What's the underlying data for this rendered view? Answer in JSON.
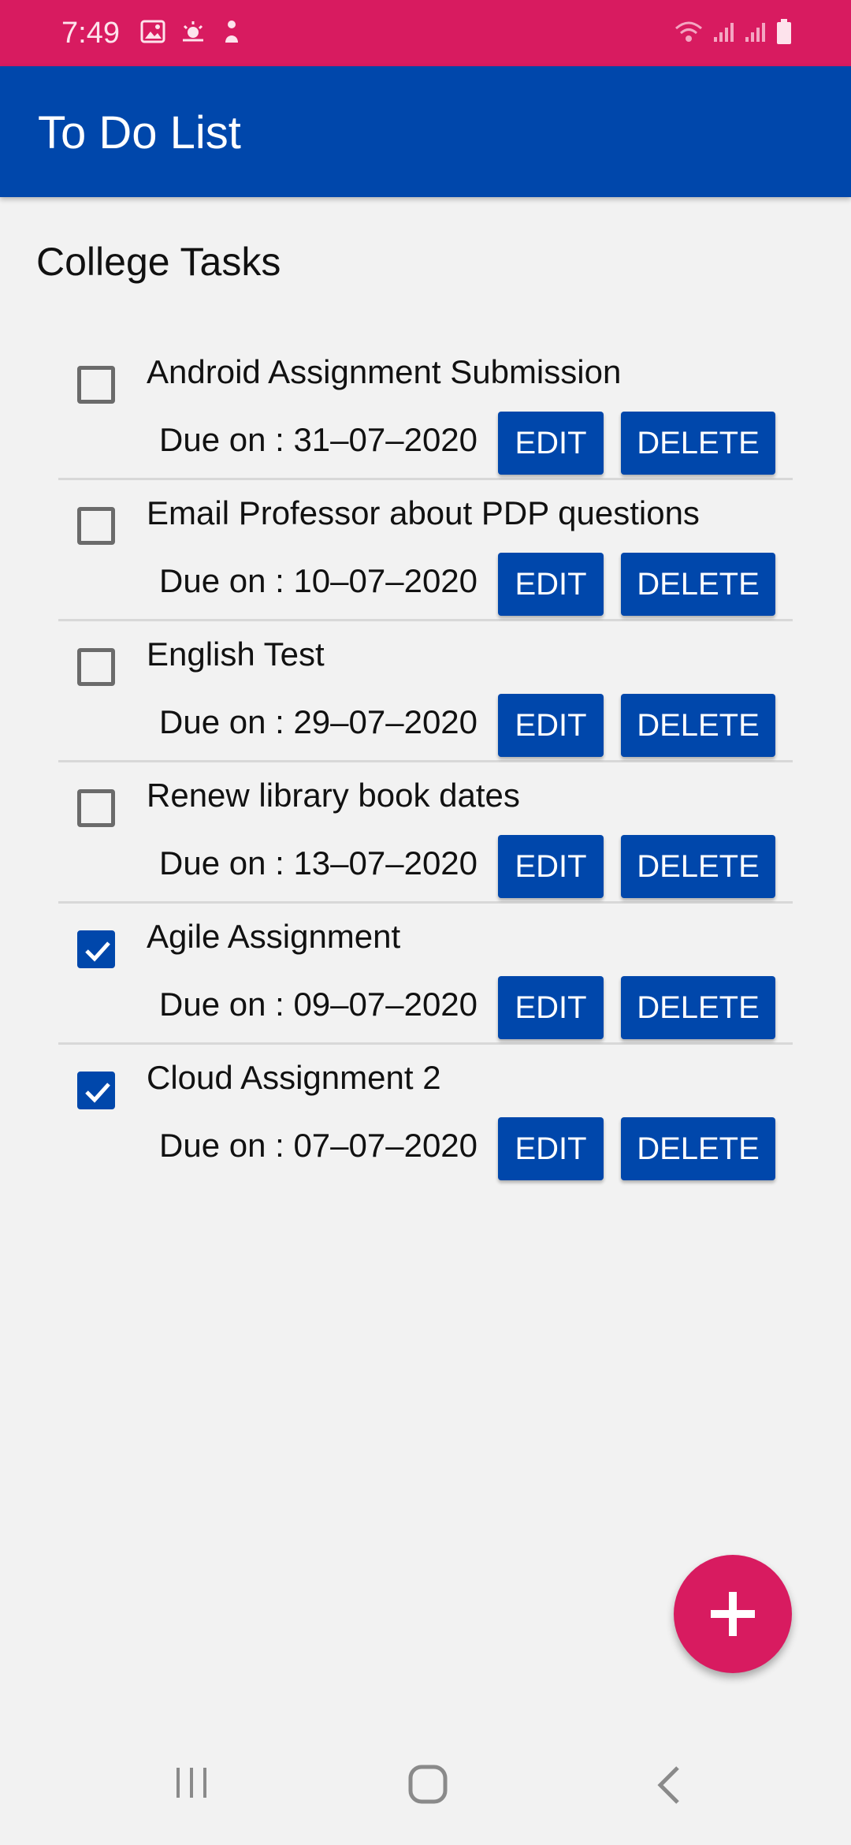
{
  "status_bar": {
    "time": "7:49",
    "left_icons": [
      "image-icon",
      "weather-icon",
      "notification-icon"
    ],
    "right_icons": [
      "wifi-icon",
      "signal-icon",
      "signal-icon",
      "battery-icon"
    ]
  },
  "app_bar": {
    "title": "To Do List"
  },
  "section": {
    "title": "College Tasks"
  },
  "buttons": {
    "edit": "EDIT",
    "delete": "DELETE"
  },
  "tasks": [
    {
      "title": "Android Assignment Submission",
      "due": "Due on : 31–07–2020",
      "checked": false
    },
    {
      "title": "Email Professor about PDP questions",
      "due": "Due on : 10–07–2020",
      "checked": false
    },
    {
      "title": "English Test",
      "due": "Due on : 29–07–2020",
      "checked": false
    },
    {
      "title": "Renew library book dates",
      "due": "Due on : 13–07–2020",
      "checked": false
    },
    {
      "title": "Agile Assignment",
      "due": "Due on : 09–07–2020",
      "checked": true
    },
    {
      "title": "Cloud Assignment 2",
      "due": "Due on : 07–07–2020",
      "checked": true
    }
  ],
  "fab": {
    "icon": "plus-icon"
  },
  "nav_bar": {
    "icons": [
      "recents-icon",
      "home-icon",
      "back-icon"
    ]
  },
  "colors": {
    "primary": "#0047ab",
    "accent": "#d81b60",
    "background": "#f2f2f2"
  }
}
